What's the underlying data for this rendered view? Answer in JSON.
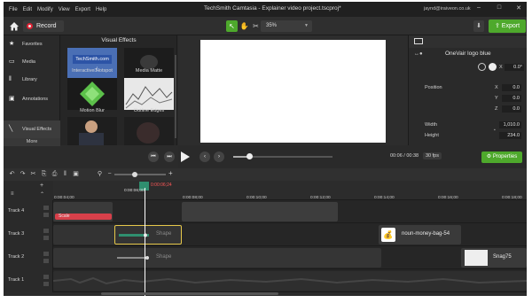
{
  "menu": [
    "File",
    "Edit",
    "Modify",
    "View",
    "Export",
    "Help"
  ],
  "window": {
    "title": "TechSmith Camtasia - Explainer video project.tscproj*",
    "email": "jaynd@iraiveon.co.uk",
    "minimize": "–",
    "maximize": "□",
    "close": "✕"
  },
  "toolbar": {
    "record_label": "Record",
    "zoom_value": "35%",
    "export_label": "Export"
  },
  "sidenav": {
    "items": [
      {
        "label": "Favorites",
        "icon": "star-icon"
      },
      {
        "label": "Media",
        "icon": "media-icon"
      },
      {
        "label": "Library",
        "icon": "library-icon"
      },
      {
        "label": "Annotations",
        "icon": "annotations-icon"
      },
      {
        "label": "Visual Effects",
        "icon": "visual-effects-icon"
      }
    ],
    "more_label": "More"
  },
  "effects": {
    "title": "Visual Effects",
    "items": [
      {
        "label": "Interactive Hotspot",
        "thumb_text": "TechSmith.com"
      },
      {
        "label": "Media Matte"
      },
      {
        "label": "Motion Blur"
      },
      {
        "label": "Outline Edges"
      }
    ]
  },
  "properties": {
    "clip_name": "OneVair logo blue",
    "rotation_x_label": "X",
    "rotation_x": "0.0°",
    "position_label": "Position",
    "x_label": "X",
    "y_label": "Y",
    "z_label": "Z",
    "pos_x": "0.0",
    "pos_y": "0.0",
    "pos_z": "0.0",
    "width_label": "Width",
    "height_label": "Height",
    "width": "1,010.0",
    "height": "234.0",
    "properties_button": "Properties"
  },
  "playback": {
    "time": "00:06 / 00:38",
    "fps": "30 fps",
    "progress": 0.16
  },
  "ruler": {
    "playhead_time": "0:00:06;24",
    "playhead_time_lower": "0:00:06;00",
    "ticks": [
      "0:00:00;00",
      "0:00:04;00",
      "0:00:08;00",
      "0:00:10;00",
      "0:00:12;00",
      "0:00:14;00",
      "0:00:16;00",
      "0:00:18;00"
    ],
    "ticks_visible": [
      "0:00:04;00",
      "0:00:08;00",
      "0:00:10;00",
      "0:00:12;00",
      "0:00:14;00",
      "0:00:16;00",
      "0:00:18;00"
    ]
  },
  "tracks": [
    {
      "name": "Track 4"
    },
    {
      "name": "Track 3"
    },
    {
      "name": "Track 2"
    },
    {
      "name": "Track 1"
    }
  ],
  "clips": {
    "scale_label": "Scale",
    "shape_label_1": "Shape",
    "shape_label_2": "Shape",
    "noun_label": "noun-money-bag-54",
    "snag_label": "Snag75"
  },
  "colors": {
    "accent_green": "#4ea92c",
    "scale_red": "#d8404a",
    "clip_teal": "#2f8f6f",
    "selection_yellow": "#e6c84a"
  }
}
